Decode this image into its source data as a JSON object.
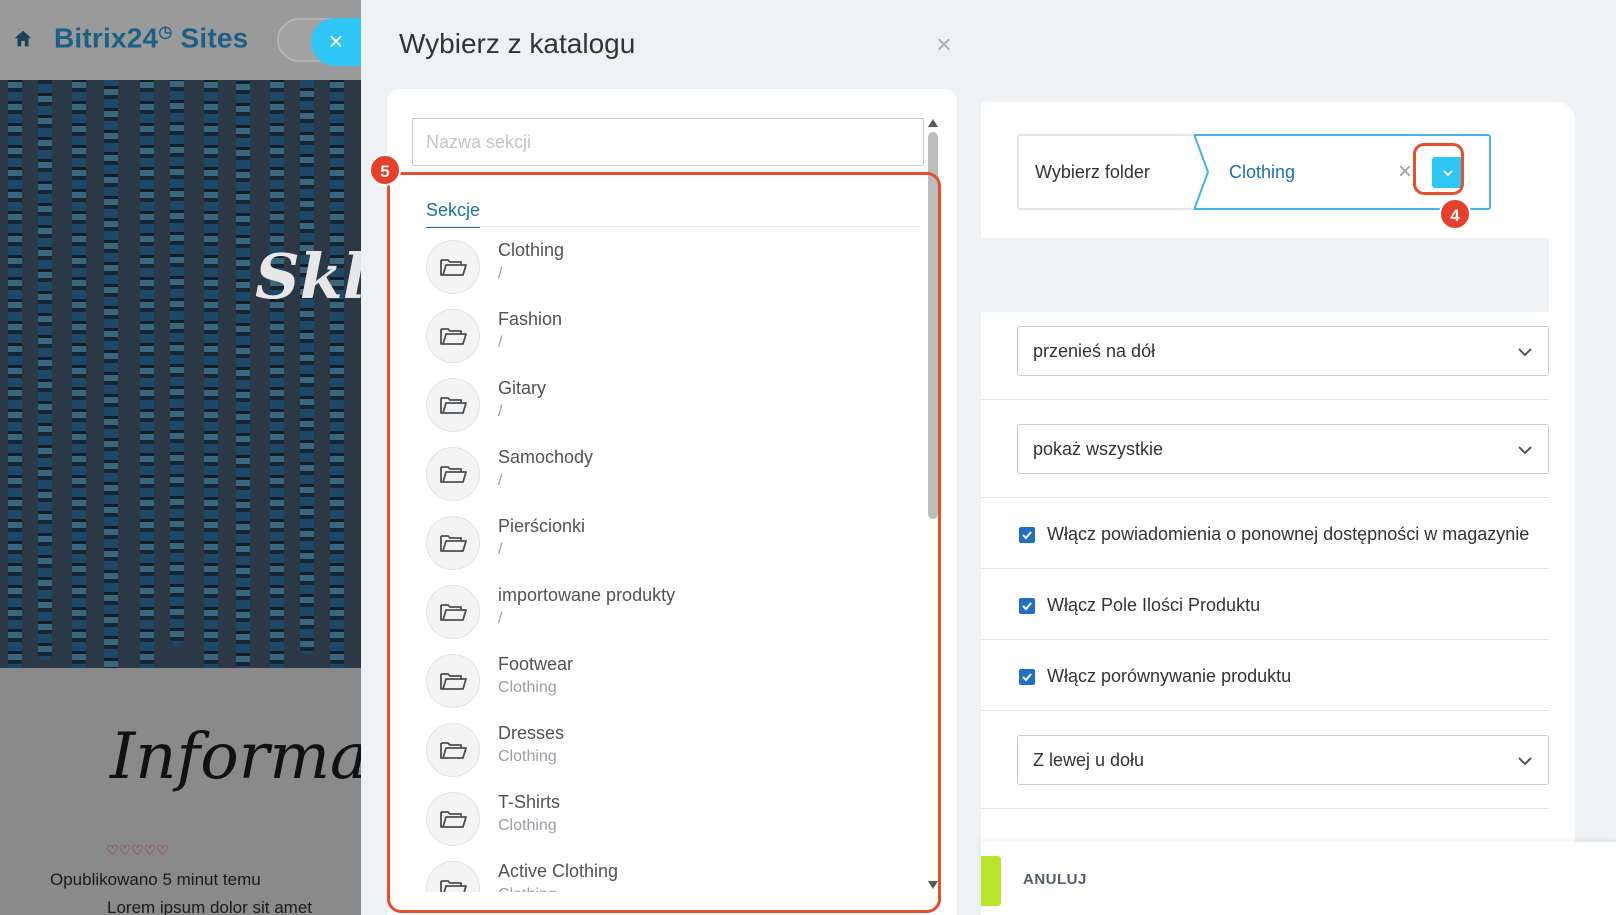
{
  "background_site": {
    "brand": "Bitrix24",
    "brand_suffix": "Sites",
    "close_glyph": "×",
    "hero_title": "Skl",
    "info_heading": "Informa",
    "hearts": "♡♡♡♡♡",
    "published": "Opublikowano 5 minut temu",
    "lorem": "Lorem ipsum dolor sit amet"
  },
  "catalog_panel": {
    "title": "Wybierz z katalogu",
    "close_glyph": "×",
    "search_placeholder": "Nazwa sekcji",
    "tab_label": "Sekcje",
    "highlight_badge": "5",
    "sections": [
      {
        "name": "Clothing",
        "path": "/"
      },
      {
        "name": "Fashion",
        "path": "/"
      },
      {
        "name": "Gitary",
        "path": "/"
      },
      {
        "name": "Samochody",
        "path": "/"
      },
      {
        "name": "Pierścionki",
        "path": "/"
      },
      {
        "name": "importowane produkty",
        "path": "/"
      },
      {
        "name": "Footwear",
        "path": "Clothing"
      },
      {
        "name": "Dresses",
        "path": "Clothing"
      },
      {
        "name": "T-Shirts",
        "path": "Clothing"
      },
      {
        "name": "Active Clothing",
        "path": "Clothing"
      }
    ]
  },
  "settings": {
    "folder_label": "Wybierz folder",
    "folder_value": "Clothing",
    "clear_glyph": "×",
    "dropdown_badge": "4",
    "select_1": "przenieś na dół",
    "select_2": "pokaż wszystkie",
    "check_1": "Włącz powiadomienia o ponownej dostępności w magazynie",
    "check_2": "Włącz Pole Ilości Produktu",
    "check_3": "Włącz porównywanie produktu",
    "select_3": "Z lewej u dołu",
    "cancel_label": "ANULUJ"
  },
  "colors": {
    "accent_blue": "#2fc6f6",
    "highlight_red": "#e5502f",
    "link_blue": "#1f6fa6",
    "save_green": "#b8e52b"
  },
  "icons": [
    "home-icon",
    "close-icon",
    "folder-icon",
    "chevron-down-icon",
    "check-icon",
    "scroll-arrow-icon"
  ]
}
